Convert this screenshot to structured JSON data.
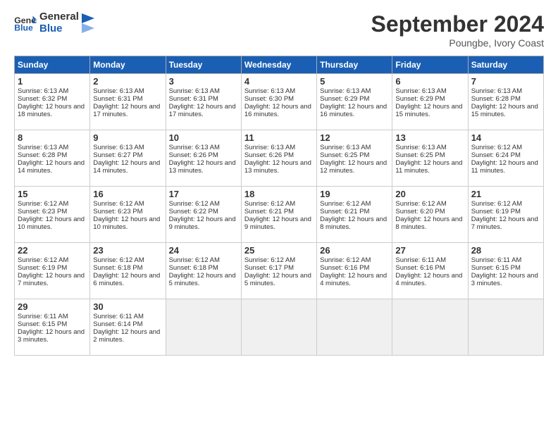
{
  "logo": {
    "line1": "General",
    "line2": "Blue"
  },
  "title": "September 2024",
  "subtitle": "Poungbe, Ivory Coast",
  "days_header": [
    "Sunday",
    "Monday",
    "Tuesday",
    "Wednesday",
    "Thursday",
    "Friday",
    "Saturday"
  ],
  "weeks": [
    [
      {
        "day": "1",
        "sunrise": "6:13 AM",
        "sunset": "6:32 PM",
        "daylight": "12 hours and 18 minutes."
      },
      {
        "day": "2",
        "sunrise": "6:13 AM",
        "sunset": "6:31 PM",
        "daylight": "12 hours and 17 minutes."
      },
      {
        "day": "3",
        "sunrise": "6:13 AM",
        "sunset": "6:31 PM",
        "daylight": "12 hours and 17 minutes."
      },
      {
        "day": "4",
        "sunrise": "6:13 AM",
        "sunset": "6:30 PM",
        "daylight": "12 hours and 16 minutes."
      },
      {
        "day": "5",
        "sunrise": "6:13 AM",
        "sunset": "6:29 PM",
        "daylight": "12 hours and 16 minutes."
      },
      {
        "day": "6",
        "sunrise": "6:13 AM",
        "sunset": "6:29 PM",
        "daylight": "12 hours and 15 minutes."
      },
      {
        "day": "7",
        "sunrise": "6:13 AM",
        "sunset": "6:28 PM",
        "daylight": "12 hours and 15 minutes."
      }
    ],
    [
      {
        "day": "8",
        "sunrise": "6:13 AM",
        "sunset": "6:28 PM",
        "daylight": "12 hours and 14 minutes."
      },
      {
        "day": "9",
        "sunrise": "6:13 AM",
        "sunset": "6:27 PM",
        "daylight": "12 hours and 14 minutes."
      },
      {
        "day": "10",
        "sunrise": "6:13 AM",
        "sunset": "6:26 PM",
        "daylight": "12 hours and 13 minutes."
      },
      {
        "day": "11",
        "sunrise": "6:13 AM",
        "sunset": "6:26 PM",
        "daylight": "12 hours and 13 minutes."
      },
      {
        "day": "12",
        "sunrise": "6:13 AM",
        "sunset": "6:25 PM",
        "daylight": "12 hours and 12 minutes."
      },
      {
        "day": "13",
        "sunrise": "6:13 AM",
        "sunset": "6:25 PM",
        "daylight": "12 hours and 11 minutes."
      },
      {
        "day": "14",
        "sunrise": "6:12 AM",
        "sunset": "6:24 PM",
        "daylight": "12 hours and 11 minutes."
      }
    ],
    [
      {
        "day": "15",
        "sunrise": "6:12 AM",
        "sunset": "6:23 PM",
        "daylight": "12 hours and 10 minutes."
      },
      {
        "day": "16",
        "sunrise": "6:12 AM",
        "sunset": "6:23 PM",
        "daylight": "12 hours and 10 minutes."
      },
      {
        "day": "17",
        "sunrise": "6:12 AM",
        "sunset": "6:22 PM",
        "daylight": "12 hours and 9 minutes."
      },
      {
        "day": "18",
        "sunrise": "6:12 AM",
        "sunset": "6:21 PM",
        "daylight": "12 hours and 9 minutes."
      },
      {
        "day": "19",
        "sunrise": "6:12 AM",
        "sunset": "6:21 PM",
        "daylight": "12 hours and 8 minutes."
      },
      {
        "day": "20",
        "sunrise": "6:12 AM",
        "sunset": "6:20 PM",
        "daylight": "12 hours and 8 minutes."
      },
      {
        "day": "21",
        "sunrise": "6:12 AM",
        "sunset": "6:19 PM",
        "daylight": "12 hours and 7 minutes."
      }
    ],
    [
      {
        "day": "22",
        "sunrise": "6:12 AM",
        "sunset": "6:19 PM",
        "daylight": "12 hours and 7 minutes."
      },
      {
        "day": "23",
        "sunrise": "6:12 AM",
        "sunset": "6:18 PM",
        "daylight": "12 hours and 6 minutes."
      },
      {
        "day": "24",
        "sunrise": "6:12 AM",
        "sunset": "6:18 PM",
        "daylight": "12 hours and 5 minutes."
      },
      {
        "day": "25",
        "sunrise": "6:12 AM",
        "sunset": "6:17 PM",
        "daylight": "12 hours and 5 minutes."
      },
      {
        "day": "26",
        "sunrise": "6:12 AM",
        "sunset": "6:16 PM",
        "daylight": "12 hours and 4 minutes."
      },
      {
        "day": "27",
        "sunrise": "6:11 AM",
        "sunset": "6:16 PM",
        "daylight": "12 hours and 4 minutes."
      },
      {
        "day": "28",
        "sunrise": "6:11 AM",
        "sunset": "6:15 PM",
        "daylight": "12 hours and 3 minutes."
      }
    ],
    [
      {
        "day": "29",
        "sunrise": "6:11 AM",
        "sunset": "6:15 PM",
        "daylight": "12 hours and 3 minutes."
      },
      {
        "day": "30",
        "sunrise": "6:11 AM",
        "sunset": "6:14 PM",
        "daylight": "12 hours and 2 minutes."
      },
      null,
      null,
      null,
      null,
      null
    ]
  ]
}
